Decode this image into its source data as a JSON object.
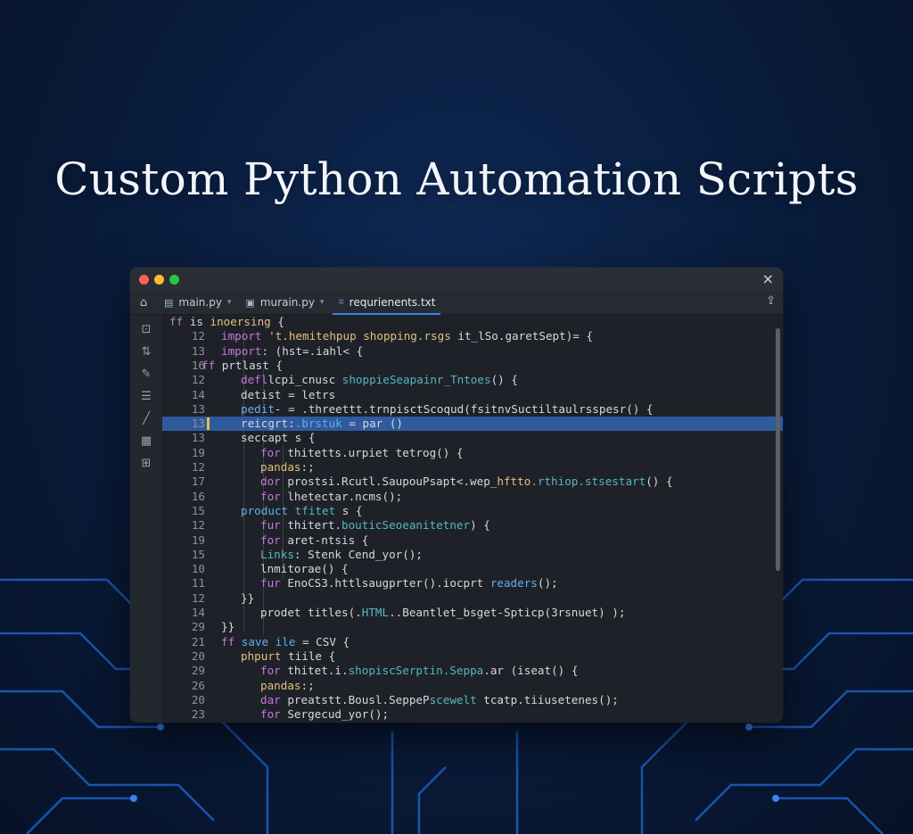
{
  "title": "Custom Python Automation Scripts",
  "colors": {
    "accent": "#3b82f6",
    "highlight": "#2f5a9e",
    "background": "#0a1d3e"
  },
  "window": {
    "close_icon": "×",
    "tabs": [
      {
        "label": "main.py",
        "icon": "file-icon",
        "active": false
      },
      {
        "label": "murain.py",
        "icon": "file-icon",
        "active": false
      },
      {
        "label": "requrienents.txt",
        "icon": "file-icon",
        "active": true
      }
    ],
    "sidebar_icons": [
      "files-icon",
      "git-icon",
      "edit-icon",
      "list-icon",
      "pencil-icon",
      "panel-icon",
      "extensions-icon"
    ],
    "highlighted_line": 7,
    "code_lines": [
      {
        "num": "",
        "indent": 0,
        "segments": [
          {
            "c": "kw",
            "t": "ff "
          },
          {
            "c": "tx",
            "t": "is "
          },
          {
            "c": "yl",
            "t": "inoersing "
          },
          {
            "c": "tx",
            "t": "{"
          }
        ]
      },
      {
        "num": "12",
        "indent": 1,
        "segments": [
          {
            "c": "kw",
            "t": "import "
          },
          {
            "c": "yl",
            "t": "'t.hemitehpup shopping.rsgs "
          },
          {
            "c": "tx",
            "t": "it_lSo.garetSept)= {"
          }
        ]
      },
      {
        "num": "13",
        "indent": 1,
        "segments": [
          {
            "c": "kw",
            "t": "import"
          },
          {
            "c": "tx",
            "t": ": (hst=.iahl< {"
          }
        ]
      },
      {
        "num": "16",
        "indent": 0,
        "segments": [
          {
            "c": "kw",
            "t": "ff "
          },
          {
            "c": "tx",
            "t": "prtlast {"
          }
        ]
      },
      {
        "num": "12",
        "indent": 2,
        "segments": [
          {
            "c": "kw",
            "t": "defl"
          },
          {
            "c": "tx",
            "t": "lcpi_cnusc "
          },
          {
            "c": "cy",
            "t": "shoppieSeapainr_Tntoes"
          },
          {
            "c": "tx",
            "t": "() {"
          }
        ]
      },
      {
        "num": "14",
        "indent": 2,
        "segments": [
          {
            "c": "tx",
            "t": "detist = letrs"
          }
        ]
      },
      {
        "num": "13",
        "indent": 2,
        "segments": [
          {
            "c": "fn",
            "t": "pedit"
          },
          {
            "c": "tx",
            "t": "- = .threettt.trnpisctScoqud(fsitnvSuctiltaulrsspesr() {"
          }
        ]
      },
      {
        "num": "13",
        "indent": 2,
        "segments": [
          {
            "c": "tx",
            "t": "reicgrt:"
          },
          {
            "c": "fn",
            "t": ".brstuk "
          },
          {
            "c": "tx",
            "t": "= par ()"
          }
        ]
      },
      {
        "num": "13",
        "indent": 2,
        "segments": [
          {
            "c": "tx",
            "t": "seccapt s {"
          }
        ]
      },
      {
        "num": "19",
        "indent": 3,
        "segments": [
          {
            "c": "kw",
            "t": "for "
          },
          {
            "c": "tx",
            "t": "thitetts.urpiet tetrog() {"
          }
        ]
      },
      {
        "num": "12",
        "indent": 3,
        "segments": [
          {
            "c": "yl",
            "t": "pandas"
          },
          {
            "c": "tx",
            "t": ":;"
          }
        ]
      },
      {
        "num": "17",
        "indent": 3,
        "segments": [
          {
            "c": "kw",
            "t": "dor "
          },
          {
            "c": "tx",
            "t": "prostsi.Rcutl.SaupouPsapt<.wep_"
          },
          {
            "c": "yl",
            "t": "hftto"
          },
          {
            "c": "cy",
            "t": ".rthiop.stsestart"
          },
          {
            "c": "tx",
            "t": "() {"
          }
        ]
      },
      {
        "num": "16",
        "indent": 3,
        "segments": [
          {
            "c": "kw",
            "t": "for "
          },
          {
            "c": "tx",
            "t": "lhetectar.ncms();"
          }
        ]
      },
      {
        "num": "15",
        "indent": 2,
        "segments": [
          {
            "c": "fn",
            "t": "product "
          },
          {
            "c": "cy",
            "t": "tfitet "
          },
          {
            "c": "tx",
            "t": "s {"
          }
        ]
      },
      {
        "num": "12",
        "indent": 3,
        "segments": [
          {
            "c": "kw",
            "t": "fur "
          },
          {
            "c": "tx",
            "t": "thitert."
          },
          {
            "c": "cy",
            "t": "bouticSeoeanitetner"
          },
          {
            "c": "tx",
            "t": ") {"
          }
        ]
      },
      {
        "num": "19",
        "indent": 3,
        "segments": [
          {
            "c": "kw",
            "t": "for "
          },
          {
            "c": "tx",
            "t": "aret-ntsis {"
          }
        ]
      },
      {
        "num": "15",
        "indent": 3,
        "segments": [
          {
            "c": "cy",
            "t": "Links"
          },
          {
            "c": "tx",
            "t": ": Stenk Cend_yor();"
          }
        ]
      },
      {
        "num": "10",
        "indent": 3,
        "segments": [
          {
            "c": "tx",
            "t": "lnmitorae() {"
          }
        ]
      },
      {
        "num": "11",
        "indent": 3,
        "segments": [
          {
            "c": "kw",
            "t": "fur "
          },
          {
            "c": "tx",
            "t": "EnoCS3.httlsaugprter().iocprt "
          },
          {
            "c": "fn",
            "t": "readers"
          },
          {
            "c": "tx",
            "t": "();"
          }
        ]
      },
      {
        "num": "12",
        "indent": 2,
        "segments": [
          {
            "c": "tx",
            "t": "}}"
          }
        ]
      },
      {
        "num": "14",
        "indent": 3,
        "segments": [
          {
            "c": "tx",
            "t": "prodet "
          },
          {
            "c": "tx",
            "t": "titles(."
          },
          {
            "c": "cy",
            "t": "HTML"
          },
          {
            "c": "tx",
            "t": "..Beantlet_bsget-Spticp(3rsnuet) );"
          }
        ]
      },
      {
        "num": "29",
        "indent": 1,
        "segments": [
          {
            "c": "tx",
            "t": "}}"
          }
        ]
      },
      {
        "num": "21",
        "indent": 1,
        "segments": [
          {
            "c": "kw",
            "t": "ff "
          },
          {
            "c": "fn",
            "t": "save ile "
          },
          {
            "c": "tx",
            "t": "= CSV {"
          }
        ]
      },
      {
        "num": "20",
        "indent": 2,
        "segments": [
          {
            "c": "yl",
            "t": "phpurt "
          },
          {
            "c": "tx",
            "t": "tiile {"
          }
        ]
      },
      {
        "num": "29",
        "indent": 3,
        "segments": [
          {
            "c": "kw",
            "t": "for "
          },
          {
            "c": "tx",
            "t": "thitet.i."
          },
          {
            "c": "cy",
            "t": "shopiscSerptin.Seppa"
          },
          {
            "c": "tx",
            "t": ".ar (iseat() {"
          }
        ]
      },
      {
        "num": "26",
        "indent": 3,
        "segments": [
          {
            "c": "yl",
            "t": "pandas"
          },
          {
            "c": "tx",
            "t": ":;"
          }
        ]
      },
      {
        "num": "20",
        "indent": 3,
        "segments": [
          {
            "c": "kw",
            "t": "dar "
          },
          {
            "c": "tx",
            "t": "preatstt.Bousl.SeppeP"
          },
          {
            "c": "cy",
            "t": "scewelt"
          },
          {
            "c": "tx",
            "t": " tcatp.tiiusetenes();"
          }
        ]
      },
      {
        "num": "23",
        "indent": 3,
        "segments": [
          {
            "c": "kw",
            "t": "for "
          },
          {
            "c": "tx",
            "t": "Sergecud_yor();"
          }
        ]
      }
    ]
  }
}
